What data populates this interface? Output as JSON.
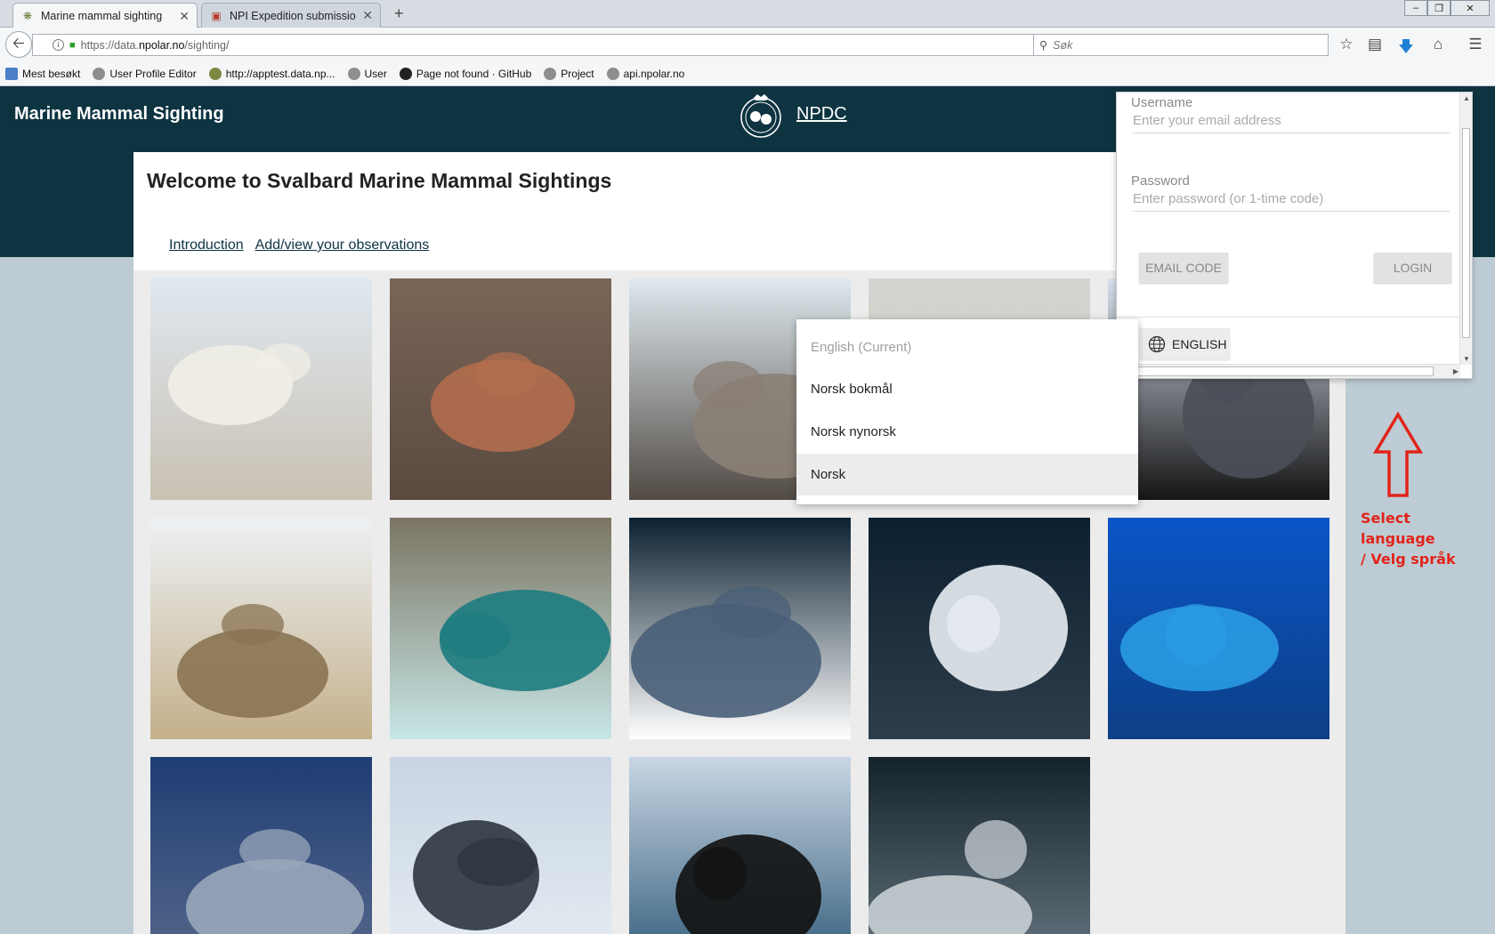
{
  "browser": {
    "tabs": [
      {
        "title": "Marine mammal sighting",
        "active": true
      },
      {
        "title": "NPI Expedition submission ...",
        "active": false
      }
    ],
    "new_tab": "+",
    "url_prefix": "https://data.",
    "url_host": "npolar.no",
    "url_path": "/sighting/",
    "search_placeholder": "Søk",
    "bookmarks": [
      "Mest besøkt",
      "User Profile Editor",
      "http://apptest.data.np...",
      "User",
      "Page not found · GitHub",
      "Project",
      "api.npolar.no"
    ],
    "window_controls": [
      "–",
      "❐",
      "✕"
    ]
  },
  "header": {
    "site_title": "Marine Mammal Sighting",
    "npdc_link": "NPDC"
  },
  "main": {
    "title": "Welcome to Svalbard Marine Mammal Sightings",
    "nav": {
      "introduction": "Introduction",
      "observations": "Add/view your observations"
    }
  },
  "gallery": {
    "tiles": [
      {
        "name": "polar-bear-cub",
        "colors": [
          "#dfe8f0",
          "#f1eee6",
          "#c9c1b3"
        ]
      },
      {
        "name": "walrus",
        "colors": [
          "#7a6556",
          "#b36d4e",
          "#5a4a40"
        ]
      },
      {
        "name": "bearded-seal",
        "colors": [
          "#dfe9ef",
          "#8a7f76",
          "#514a44"
        ]
      },
      {
        "name": "ringed-seal-on-sand",
        "colors": [
          "#d5d4d0",
          "#3b3a3a",
          "#c7c2b8"
        ]
      },
      {
        "name": "hooded-seal",
        "colors": [
          "#d8e0ee",
          "#4b4f58",
          "#151515"
        ]
      },
      {
        "name": "ringed-seal-pup",
        "colors": [
          "#eef1f5",
          "#8a7352",
          "#c4b08a"
        ]
      },
      {
        "name": "belugas",
        "colors": [
          "#7b7563",
          "#1d7c80",
          "#c7e6e6"
        ]
      },
      {
        "name": "whale-aerial-1",
        "colors": [
          "#0b2030",
          "#485f78",
          "#ffffff"
        ]
      },
      {
        "name": "whale-aerial-2",
        "colors": [
          "#0d2030",
          "#e8eef3",
          "#2e3d4a"
        ]
      },
      {
        "name": "blue-whale-underwater",
        "colors": [
          "#0a55c7",
          "#2a9be3",
          "#0d3f86"
        ]
      },
      {
        "name": "fin-whale-blow",
        "colors": [
          "#1e3d74",
          "#9aa7bb",
          "#5a6b8c"
        ]
      },
      {
        "name": "humpback-breach",
        "colors": [
          "#c8d5e3",
          "#2c3440",
          "#e8eef4"
        ]
      },
      {
        "name": "orca-breach",
        "colors": [
          "#c9d7e4",
          "#111111",
          "#2b5675"
        ]
      },
      {
        "name": "narwhals-aerial",
        "colors": [
          "#14222c",
          "#c8cfd4",
          "#6b7a84"
        ]
      }
    ]
  },
  "login": {
    "username_label": "Username",
    "username_placeholder": "Enter your email address",
    "password_label": "Password",
    "password_placeholder": "Enter password (or 1-time code)",
    "email_code_button": "EMAIL CODE",
    "login_button": "LOGIN",
    "language_button": "ENGLISH"
  },
  "language_menu": {
    "options": [
      {
        "label": "English (Current)",
        "state": "current"
      },
      {
        "label": "Norsk bokmål",
        "state": "normal"
      },
      {
        "label": "Norsk nynorsk",
        "state": "normal"
      },
      {
        "label": "Norsk",
        "state": "hover"
      }
    ]
  },
  "annotation": {
    "line1": "Select language",
    "line2": "/ Velg språk",
    "color": "#e2231a"
  },
  "colors": {
    "header_bg": "#0e3441",
    "page_bg": "#bdccd4",
    "link": "#0e3441"
  }
}
